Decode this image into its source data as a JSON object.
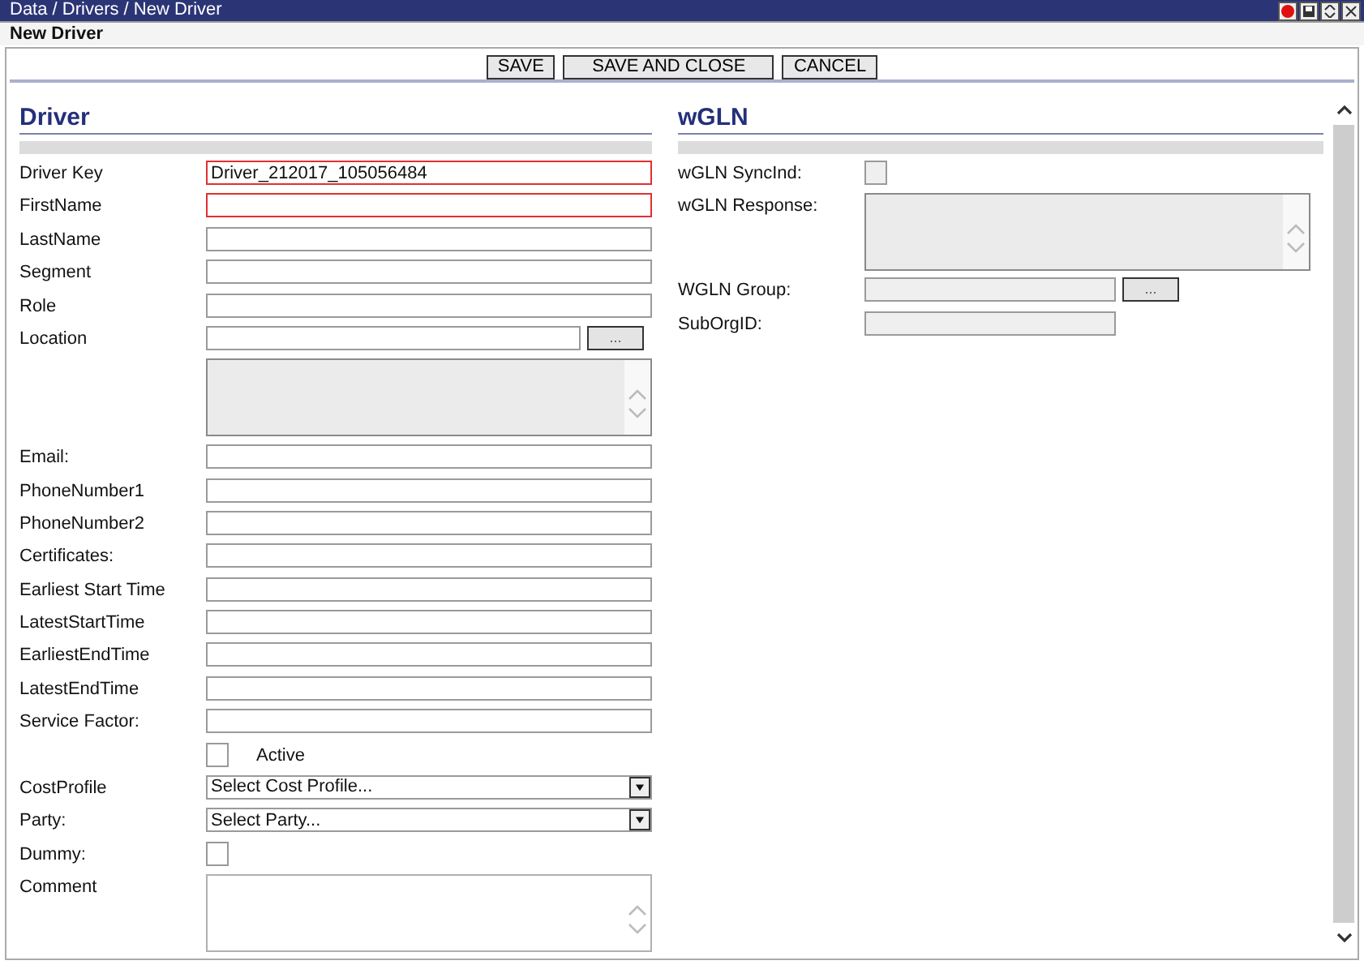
{
  "window": {
    "title": "Data / Drivers / New Driver"
  },
  "page_title": "New Driver",
  "toolbar": [
    {
      "label": "SAVE"
    },
    {
      "label": "SAVE AND CLOSE"
    },
    {
      "label": "CANCEL"
    }
  ],
  "sections": [
    {
      "title": "Driver",
      "fields": [
        {
          "kind": "text",
          "label": "Driver Key",
          "value": "Driver_212017_105056484",
          "required": true,
          "disabled": false
        },
        {
          "kind": "text",
          "label": "FirstName",
          "required": true,
          "disabled": false
        },
        {
          "kind": "text",
          "label": "LastName",
          "required": false,
          "disabled": false
        },
        {
          "kind": "text",
          "label": "Segment",
          "required": false,
          "disabled": false
        },
        {
          "kind": "text",
          "label": "Role",
          "required": false,
          "disabled": false
        },
        {
          "kind": "lookup",
          "label": "Location",
          "button": "...",
          "required": false,
          "disabled": false
        },
        {
          "kind": "textarea",
          "disabled": true
        },
        {
          "kind": "text",
          "label": "Email:",
          "required": false,
          "disabled": false
        },
        {
          "kind": "text",
          "label": "PhoneNumber1",
          "required": false,
          "disabled": false
        },
        {
          "kind": "text",
          "label": "PhoneNumber2",
          "required": false,
          "disabled": false
        },
        {
          "kind": "text",
          "label": "Certificates:",
          "required": false,
          "disabled": false
        },
        {
          "kind": "text",
          "label": "Earliest Start Time",
          "required": false,
          "disabled": false
        },
        {
          "kind": "text",
          "label": "LatestStartTime",
          "required": false,
          "disabled": false
        },
        {
          "kind": "text",
          "label": "EarliestEndTime",
          "required": false,
          "disabled": false
        },
        {
          "kind": "text",
          "label": "LatestEndTime",
          "required": false,
          "disabled": false
        },
        {
          "kind": "text",
          "label": "Service Factor:",
          "required": false,
          "disabled": false
        },
        {
          "kind": "checkbox",
          "caption": "Active",
          "checked": false,
          "disabled": false
        },
        {
          "kind": "select",
          "label": "CostProfile",
          "value": "Select Cost Profile..."
        },
        {
          "kind": "select",
          "label": "Party:",
          "value": "Select Party..."
        },
        {
          "kind": "checkbox",
          "label": "Dummy:",
          "checked": false,
          "disabled": false
        },
        {
          "kind": "textarea",
          "label": "Comment",
          "disabled": false
        }
      ]
    },
    {
      "title": "wGLN",
      "fields": [
        {
          "kind": "checkbox",
          "label": "wGLN SyncInd:",
          "checked": false,
          "disabled": true
        },
        {
          "kind": "textarea",
          "label": "wGLN Response:",
          "disabled": true
        },
        {
          "kind": "lookup",
          "label": "WGLN Group:",
          "button": "...",
          "required": false,
          "disabled": true,
          "short": true
        },
        {
          "kind": "text",
          "label": "SubOrgID:",
          "required": false,
          "disabled": true,
          "short": true
        }
      ]
    }
  ]
}
